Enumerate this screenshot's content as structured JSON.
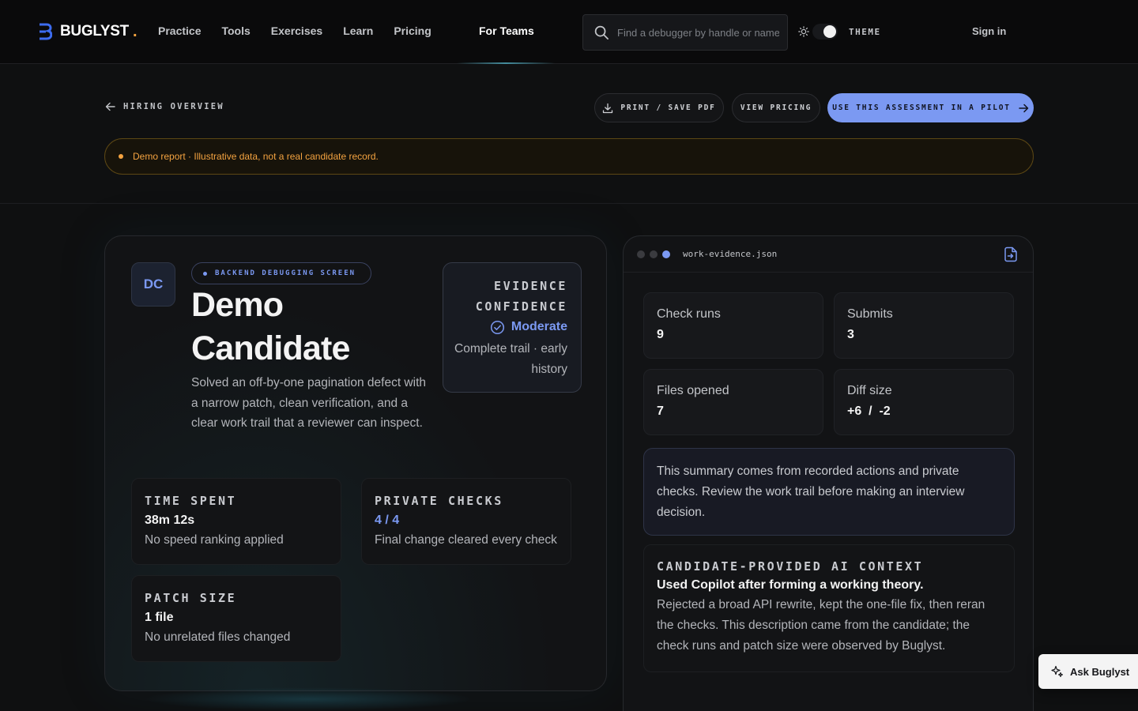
{
  "nav": {
    "brand": "BUGLYST",
    "brand_dot": ".",
    "links": [
      "Practice",
      "Tools",
      "Exercises",
      "Learn",
      "Pricing"
    ],
    "teams_link": "For Teams",
    "search_placeholder": "Find a debugger by handle or name",
    "theme_label": "THEME",
    "signin": "Sign in"
  },
  "subheader": {
    "back_label": "HIRING OVERVIEW",
    "print_label": "PRINT / SAVE PDF",
    "pricing_label": "VIEW PRICING",
    "pilot_label": "USE THIS ASSESSMENT IN A PILOT"
  },
  "banner": {
    "text": "Demo report · Illustrative data, not a real candidate record."
  },
  "candidate": {
    "initials": "DC",
    "tag": "BACKEND DEBUGGING SCREEN",
    "name": "Demo Candidate",
    "description": "Solved an off-by-one pagination defect with a narrow patch, clean verification, and a clear work trail that a reviewer can inspect.",
    "confidence": {
      "label": "EVIDENCE CONFIDENCE",
      "value": "Moderate",
      "note": "Complete trail · early history"
    },
    "stats": [
      {
        "label": "TIME SPENT",
        "value": "38m 12s",
        "note": "No speed ranking applied"
      },
      {
        "label": "PRIVATE CHECKS",
        "value": "4 / 4",
        "note": "Final change cleared every check"
      },
      {
        "label": "PATCH SIZE",
        "value": "1 file",
        "note": "No unrelated files changed"
      }
    ]
  },
  "evidence": {
    "file_name": "work-evidence.json",
    "metrics": [
      {
        "label": "Check runs",
        "value": "9"
      },
      {
        "label": "Submits",
        "value": "3"
      },
      {
        "label": "Files opened",
        "value": "7"
      },
      {
        "label": "Diff size",
        "value": "+6  /  -2"
      }
    ],
    "summary": "This summary comes from recorded actions and private checks. Review the work trail before making an interview decision.",
    "ai_context": {
      "label": "CANDIDATE-PROVIDED AI CONTEXT",
      "title": "Used Copilot after forming a working theory.",
      "text": "Rejected a broad API rewrite, kept the one-file fix, then reran the checks. This description came from the candidate; the check runs and patch size were observed by Buglyst."
    }
  },
  "assistant": {
    "label": "Ask Buglyst"
  },
  "colors": {
    "accent": "#7b99f2",
    "warning": "#f4a340",
    "background": "#0f1011"
  }
}
